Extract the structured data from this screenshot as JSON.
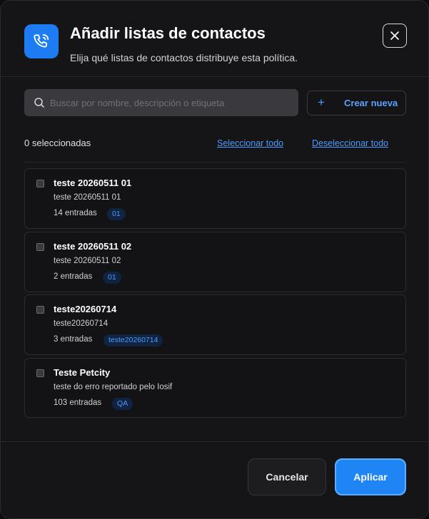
{
  "header": {
    "icon": "phone-call-icon",
    "title": "Añadir listas de contactos",
    "subtitle": "Elija qué listas de contactos distribuye esta política.",
    "close_icon": "close-icon"
  },
  "search": {
    "icon": "search-icon",
    "placeholder": "Buscar por nombre, descripción o etiqueta",
    "value": ""
  },
  "create_button": {
    "icon": "+",
    "label": "Crear nueva"
  },
  "selection": {
    "count_text": "0 seleccionadas",
    "select_all": "Seleccionar todo",
    "deselect_all": "Deseleccionar todo"
  },
  "lists": [
    {
      "name": "teste 20260511 01",
      "description": "teste 20260511 01",
      "entries": "14 entradas",
      "tag": "01",
      "checked": false
    },
    {
      "name": "teste 20260511 02",
      "description": "teste 20260511 02",
      "entries": "2 entradas",
      "tag": "01",
      "checked": false
    },
    {
      "name": "teste20260714",
      "description": "teste20260714",
      "entries": "3 entradas",
      "tag": "teste20260714",
      "checked": false
    },
    {
      "name": "Teste Petcity",
      "description": "teste do erro reportado pelo Iosif",
      "entries": "103 entradas",
      "tag": "QA",
      "checked": false
    }
  ],
  "footer": {
    "cancel": "Cancelar",
    "apply": "Aplicar"
  },
  "colors": {
    "accent": "#1f85f5",
    "link": "#4d9bff",
    "background": "#151517",
    "tag_bg": "#102341"
  }
}
